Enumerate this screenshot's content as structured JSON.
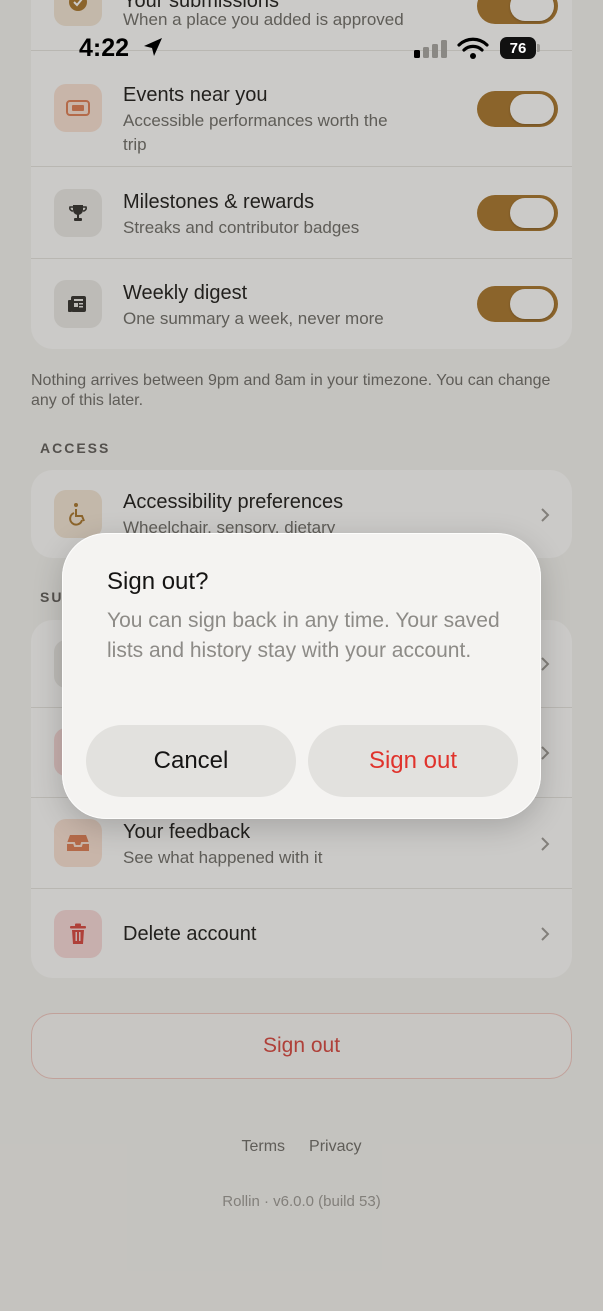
{
  "status_bar": {
    "time": "4:22",
    "battery": "76"
  },
  "notifications": {
    "items": [
      {
        "title": "Your submissions",
        "subtitle": "When a place you added is approved",
        "enabled": true,
        "icon": "badge-check-icon"
      },
      {
        "title": "Events near you",
        "subtitle": "Accessible performances worth the trip",
        "enabled": true,
        "icon": "ticket-icon"
      },
      {
        "title": "Milestones & rewards",
        "subtitle": "Streaks and contributor badges",
        "enabled": true,
        "icon": "trophy-icon"
      },
      {
        "title": "Weekly digest",
        "subtitle": "One summary a week, never more",
        "enabled": true,
        "icon": "newspaper-icon"
      }
    ],
    "note": "Nothing arrives between 9pm and 8am in your timezone. You can change any of this later."
  },
  "access": {
    "label": "ACCESS",
    "items": [
      {
        "title": "Accessibility preferences",
        "subtitle": "Wheelchair, sensory, dietary",
        "icon": "wheelchair-icon"
      }
    ]
  },
  "support": {
    "label": "SU",
    "items": [
      {
        "title": "Your feedback",
        "subtitle": "See what happened with it",
        "icon": "inbox-icon"
      },
      {
        "title": "Delete account",
        "subtitle": "",
        "icon": "trash-icon"
      }
    ]
  },
  "sign_out_button": "Sign out",
  "footer": {
    "terms": "Terms",
    "privacy": "Privacy",
    "version": "Rollin · v6.0.0 (build 53)"
  },
  "dialog": {
    "title": "Sign out?",
    "message": "You can sign back in any time. Your saved lists and history stay with your account.",
    "cancel": "Cancel",
    "confirm": "Sign out"
  },
  "colors": {
    "toggle_on": "#a77226",
    "destructive": "#e0332c",
    "accent_peach": "#fbe2d4"
  }
}
